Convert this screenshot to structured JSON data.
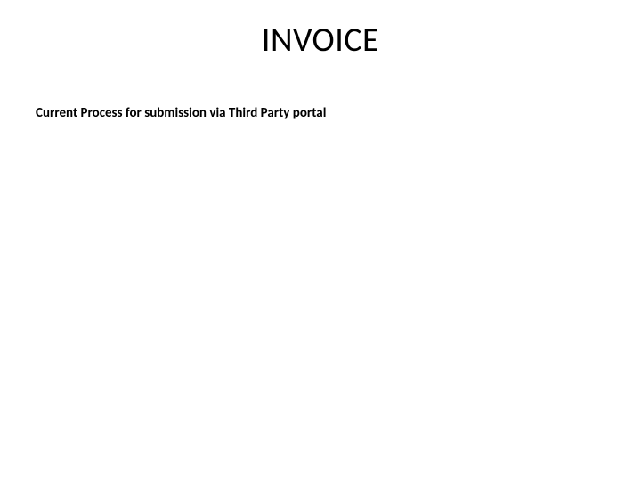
{
  "title": "INVOICE",
  "subtitle": "Current Process for submission via Third Party portal"
}
